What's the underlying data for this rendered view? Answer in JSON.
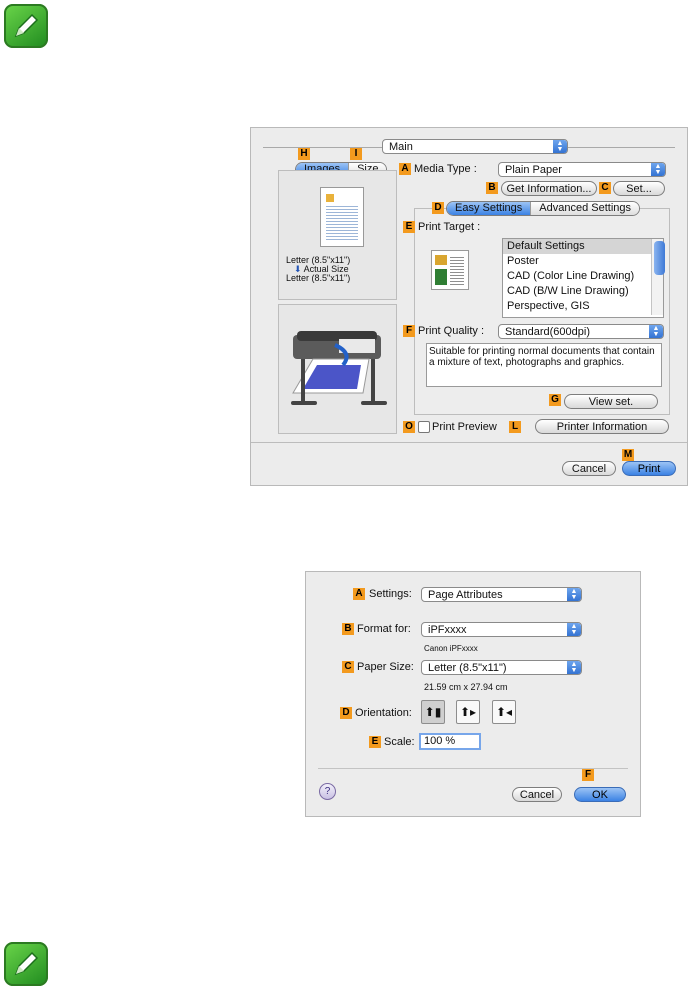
{
  "dialog1": {
    "main_select": "Main",
    "tabs_left": {
      "marker_h": "H",
      "marker_i": "I",
      "images": "Images",
      "size": "Size"
    },
    "media_type": {
      "marker": "A",
      "label": "Media Type :",
      "value": "Plain Paper"
    },
    "get_info": {
      "marker": "B",
      "label": "Get Information..."
    },
    "set": {
      "marker": "C",
      "label": "Set..."
    },
    "settings_tabs": {
      "marker": "D",
      "easy": "Easy Settings",
      "advanced": "Advanced Settings"
    },
    "print_target": {
      "marker": "E",
      "label": "Print Target :",
      "items": [
        "Default Settings",
        "Poster",
        "CAD (Color Line Drawing)",
        "CAD (B/W Line Drawing)",
        "Perspective, GIS"
      ]
    },
    "preview": {
      "line1": "Letter (8.5\"x11\")",
      "line2": "Actual Size",
      "line3": "Letter (8.5\"x11\")"
    },
    "print_quality": {
      "marker": "F",
      "label": "Print Quality :",
      "value": "Standard(600dpi)"
    },
    "description": "Suitable for printing normal documents that contain a mixture of text, photographs and graphics.",
    "view_set": {
      "marker": "G",
      "label": "View set."
    },
    "print_preview": {
      "marker": "O",
      "label": "Print Preview"
    },
    "printer_info": {
      "marker": "L",
      "label": "Printer Information"
    },
    "cancel": "Cancel",
    "print": {
      "marker": "M",
      "label": "Print"
    }
  },
  "dialog2": {
    "settings": {
      "marker": "A",
      "label": "Settings:",
      "value": "Page Attributes"
    },
    "format_for": {
      "marker": "B",
      "label": "Format for:",
      "value": "iPFxxxx",
      "sub": "Canon iPFxxxx"
    },
    "paper_size": {
      "marker": "C",
      "label": "Paper Size:",
      "value": "Letter (8.5\"x11\")",
      "sub": "21.59 cm x 27.94 cm"
    },
    "orientation": {
      "marker": "D",
      "label": "Orientation:"
    },
    "scale": {
      "marker": "E",
      "label": "Scale:",
      "value": "100 %"
    },
    "help": "?",
    "cancel": "Cancel",
    "ok": {
      "marker": "F",
      "label": "OK"
    }
  },
  "colors": {
    "marker": "#f39a1e",
    "accent": "#3b82e4",
    "note_green": "#2c9a24"
  },
  "icons": [
    "note-pencil-icon",
    "printer-illustration",
    "up-down-arrows-icon",
    "portrait-icon",
    "landscape-icon",
    "reverse-landscape-icon"
  ]
}
